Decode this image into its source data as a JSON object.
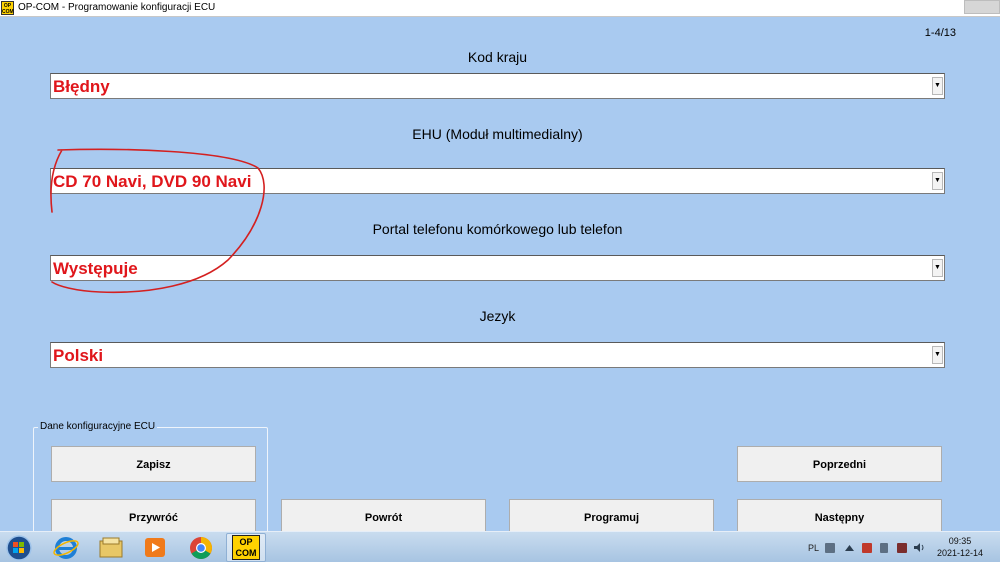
{
  "window": {
    "title": "OP-COM - Programowanie konfiguracji ECU",
    "icon_line1": "OP",
    "icon_line2": "COM"
  },
  "page_counter": "1-4/13",
  "fields": [
    {
      "label": "Kod kraju",
      "value": "Błędny"
    },
    {
      "label": "EHU (Moduł multimedialny)",
      "value": "CD 70 Navi, DVD 90 Navi"
    },
    {
      "label": "Portal telefonu komórkowego lub telefon",
      "value": "Występuje"
    },
    {
      "label": "Jezyk",
      "value": "Polski"
    }
  ],
  "value_color": "#e0161b",
  "groupbox": {
    "label": "Dane konfiguracyjne ECU"
  },
  "buttons": {
    "save": "Zapisz",
    "restore": "Przywróć",
    "back": "Powrót",
    "program": "Programuj",
    "previous": "Poprzedni",
    "next": "Następny"
  },
  "taskbar": {
    "icons": [
      "windows-start-icon",
      "internet-explorer-icon",
      "file-explorer-icon",
      "media-player-icon",
      "chrome-icon",
      "opcom-icon"
    ],
    "opcom_line1": "OP",
    "opcom_line2": "COM",
    "language": "PL",
    "time": "09:35",
    "date": "2021-12-14"
  }
}
